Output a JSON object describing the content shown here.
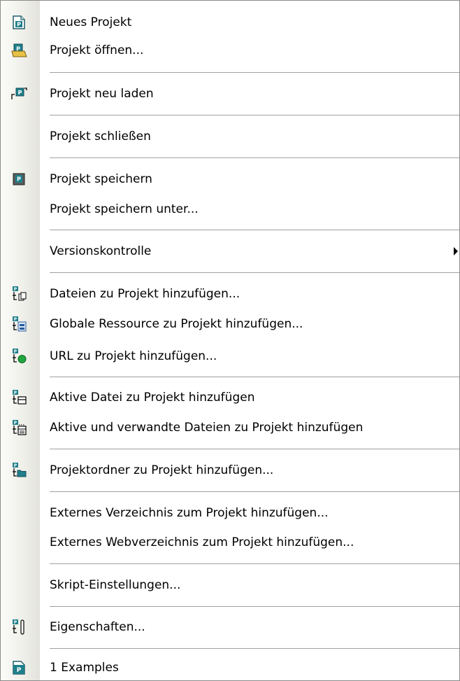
{
  "menu": {
    "items": [
      {
        "label": "Neues Projekt",
        "icon": "new-project-icon"
      },
      {
        "label": "Projekt öffnen...",
        "icon": "open-project-icon"
      },
      {
        "label": "Projekt neu laden",
        "icon": "reload-project-icon"
      },
      {
        "label": "Projekt schließen",
        "icon": ""
      },
      {
        "label": "Projekt speichern",
        "icon": "save-project-icon"
      },
      {
        "label": "Projekt speichern unter...",
        "icon": ""
      },
      {
        "label": "Versionskontrolle",
        "icon": "",
        "submenu": true
      },
      {
        "label": "Dateien zu Projekt hinzufügen...",
        "icon": "add-files-icon"
      },
      {
        "label": "Globale Ressource zu Projekt hinzufügen...",
        "icon": "add-global-resource-icon"
      },
      {
        "label": "URL zu Projekt hinzufügen...",
        "icon": "add-url-icon"
      },
      {
        "label": "Aktive Datei zu Projekt hinzufügen",
        "icon": "add-active-file-icon"
      },
      {
        "label": "Aktive und verwandte Dateien zu Projekt hinzufügen",
        "icon": "add-active-related-files-icon"
      },
      {
        "label": "Projektordner zu Projekt hinzufügen...",
        "icon": "add-project-folder-icon"
      },
      {
        "label": "Externes Verzeichnis zum Projekt hinzufügen...",
        "icon": ""
      },
      {
        "label": "Externes Webverzeichnis zum Projekt hinzufügen...",
        "icon": ""
      },
      {
        "label": "Skript-Einstellungen...",
        "icon": ""
      },
      {
        "label": "Eigenschaften...",
        "icon": "properties-icon"
      },
      {
        "label": "1 Examples",
        "icon": "recent-project-icon"
      }
    ]
  },
  "colors": {
    "accent_teal": "#1f7f8a",
    "folder_yellow": "#e8c246",
    "url_green": "#21a63f"
  }
}
